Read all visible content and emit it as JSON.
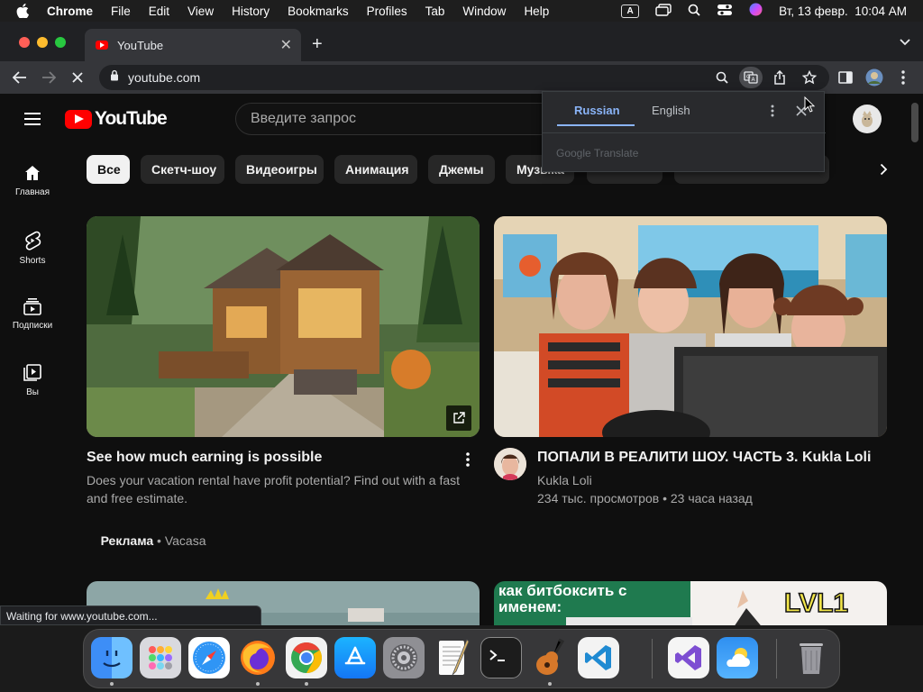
{
  "menubar": {
    "app": "Chrome",
    "items": [
      "File",
      "Edit",
      "View",
      "History",
      "Bookmarks",
      "Profiles",
      "Tab",
      "Window",
      "Help"
    ],
    "input_indicator": "A",
    "datetime": "Вт, 13 февр.  10:04 AM"
  },
  "browser": {
    "tab_title": "YouTube",
    "url": "youtube.com",
    "status_text": "Waiting for www.youtube.com..."
  },
  "translate": {
    "tab_source": "Russian",
    "tab_target": "English",
    "brand": "Google Translate"
  },
  "youtube": {
    "logo_text": "YouTube",
    "search_placeholder": "Введите запрос",
    "sidebar": [
      {
        "label": "Главная",
        "icon": "home-icon"
      },
      {
        "label": "Shorts",
        "icon": "shorts-icon"
      },
      {
        "label": "Подписки",
        "icon": "subscriptions-icon"
      },
      {
        "label": "Вы",
        "icon": "you-icon"
      }
    ],
    "chips": [
      "Все",
      "Скетч-шоу",
      "Видеоигры",
      "Анимация",
      "Джемы",
      "Музыка"
    ],
    "videos": [
      {
        "title": "See how much earning is possible",
        "desc_line1": "Does your vacation rental have profit potential? Find out with a fast",
        "desc_line2": "and free estimate.",
        "ad_label": "Реклама",
        "advertiser": " • Vacasa"
      },
      {
        "title": "ПОПАЛИ В РЕАЛИТИ ШОУ. ЧАСТЬ 3. Kukla Loli",
        "channel": "Kukla Loli",
        "stats": "234 тыс. просмотров • 23 часа назад"
      }
    ],
    "thumb3_text": "как битбоксить с именем:",
    "thumb4_text": "LVL1"
  },
  "dock": [
    "Finder",
    "Launchpad",
    "Safari",
    "Firefox",
    "Chrome",
    "App Store",
    "System Settings",
    "TextEdit",
    "Terminal",
    "GarageBand",
    "VS Code",
    "Visual Studio",
    "Weather",
    "Trash"
  ]
}
